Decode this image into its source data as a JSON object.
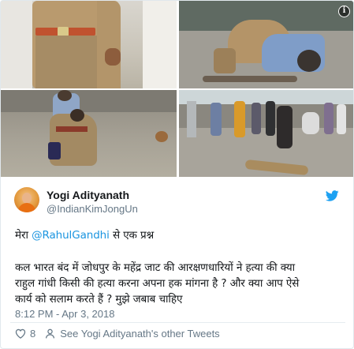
{
  "media": {
    "photo_count": 4,
    "info_icon": "info-icon"
  },
  "tweet": {
    "display_name": "Yogi Adityanath",
    "handle": "@IndianKimJongUn",
    "platform_icon": "twitter-bird-icon",
    "line1_prefix": "मेरा ",
    "line1_mention": "@RahulGandhi",
    "line1_suffix": " से एक प्रश्न",
    "line2": "कल भारत बंद में जोधपुर के महेंद्र जाट की आरक्षणधारियों ने हत्या की क्या",
    "line3": "राहुल गांधी किसी की हत्या करना अपना हक मांगना है ? और क्या आप ऐसे",
    "line4": "कार्य को सलाम करते हैं ? मुझे जबाब चाहिए",
    "timestamp": "8:12 PM - Apr 3, 2018"
  },
  "footer": {
    "like_count": "8",
    "like_icon": "heart-icon",
    "profile_icon": "person-icon",
    "see_other_label": "See Yogi Adityanath's other Tweets"
  },
  "colors": {
    "link": "#1b95e0",
    "secondary_text": "#657786",
    "primary_text": "#14171a",
    "twitter_blue": "#1da1f2"
  }
}
